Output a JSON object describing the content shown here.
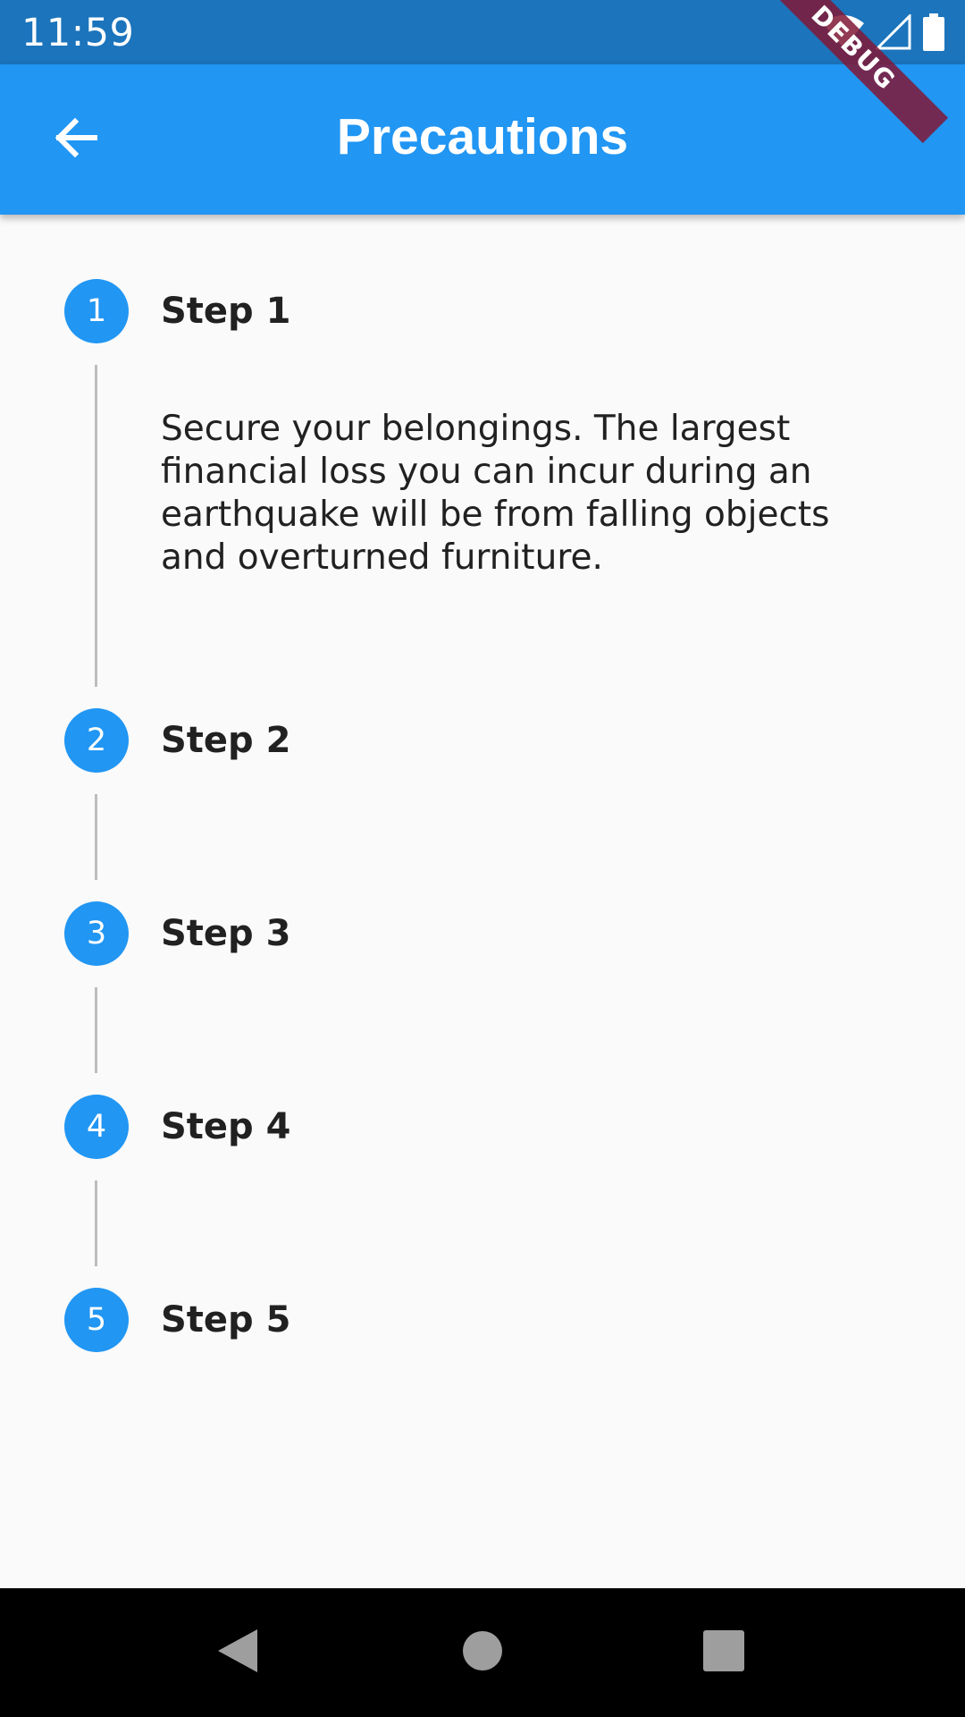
{
  "status_bar": {
    "time": "11:59",
    "icons": [
      "wifi-icon",
      "signal-icon",
      "battery-icon"
    ]
  },
  "debug_banner": {
    "label": "DEBUG",
    "color": "#801836"
  },
  "app_bar": {
    "title": "Precautions",
    "back_icon": "arrow-back-icon",
    "color": "#2196f3"
  },
  "stepper": {
    "accent_color": "#2196f3",
    "steps": [
      {
        "number": "1",
        "title": "Step 1",
        "content": "Secure your belongings. The largest financial loss you can incur during an earthquake will be from falling objects and overturned furniture.",
        "expanded": true
      },
      {
        "number": "2",
        "title": "Step 2"
      },
      {
        "number": "3",
        "title": "Step 3"
      },
      {
        "number": "4",
        "title": "Step 4"
      },
      {
        "number": "5",
        "title": "Step 5"
      }
    ]
  },
  "nav_bar": {
    "icons": [
      "nav-back-icon",
      "nav-home-icon",
      "nav-recents-icon"
    ]
  }
}
